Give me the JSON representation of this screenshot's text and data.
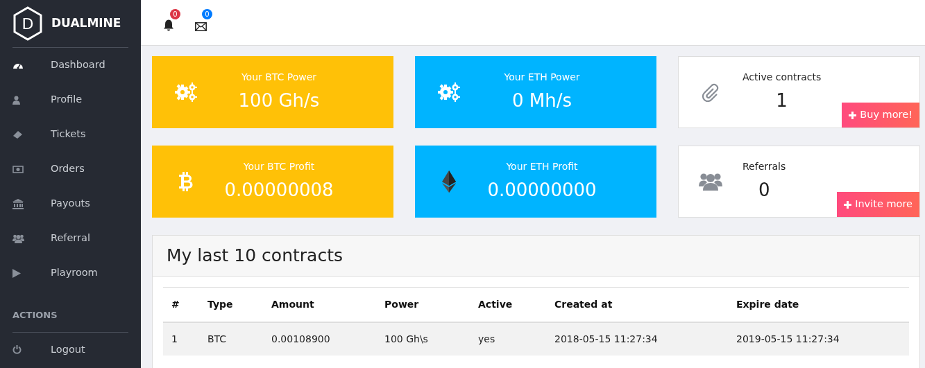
{
  "brand": {
    "logo_letter": "D",
    "name": "DUALMINE"
  },
  "sidebar": {
    "items": [
      {
        "label": "Dashboard",
        "kind": "dashboard"
      },
      {
        "label": "Profile",
        "kind": "user"
      },
      {
        "label": "Tickets",
        "kind": "ticket"
      },
      {
        "label": "Orders",
        "kind": "money"
      },
      {
        "label": "Payouts",
        "kind": "bank"
      },
      {
        "label": "Referral",
        "kind": "users"
      },
      {
        "label": "Playroom",
        "kind": "play"
      }
    ],
    "section_title": "ACTIONS",
    "actions": [
      {
        "label": "Logout",
        "kind": "power"
      }
    ]
  },
  "header": {
    "notifications": [
      {
        "kind": "bell",
        "count": "0",
        "color": "#dc3545"
      },
      {
        "kind": "mail",
        "count": "0",
        "color": "#007bff"
      }
    ]
  },
  "stats": [
    {
      "kind": "gears",
      "color": "#ffc107",
      "label": "Your BTC Power",
      "value": "100 Gh/s"
    },
    {
      "kind": "gears",
      "color": "#00b4ff",
      "label": "Your ETH Power",
      "value": "0 Mh/s"
    },
    {
      "kind": "bitcoin",
      "color": "#ffc107",
      "label": "Your BTC Profit",
      "value": "0.00000008"
    },
    {
      "kind": "ethereum",
      "color": "#00b4ff",
      "label": "Your ETH Profit",
      "value": "0.00000000"
    }
  ],
  "info_cards": [
    {
      "kind": "paperclip",
      "label": "Active contracts",
      "value": "1",
      "button": "Buy more!"
    },
    {
      "kind": "users",
      "label": "Referrals",
      "value": "0",
      "button": "Invite more"
    }
  ],
  "contracts": {
    "title": "My last 10 contracts",
    "columns": [
      "#",
      "Type",
      "Amount",
      "Power",
      "Active",
      "Created at",
      "Expire date"
    ],
    "rows": [
      [
        "1",
        "BTC",
        "0.00108900",
        "100 Gh\\s",
        "yes",
        "2018-05-15 11:27:34",
        "2019-05-15 11:27:34"
      ]
    ]
  }
}
